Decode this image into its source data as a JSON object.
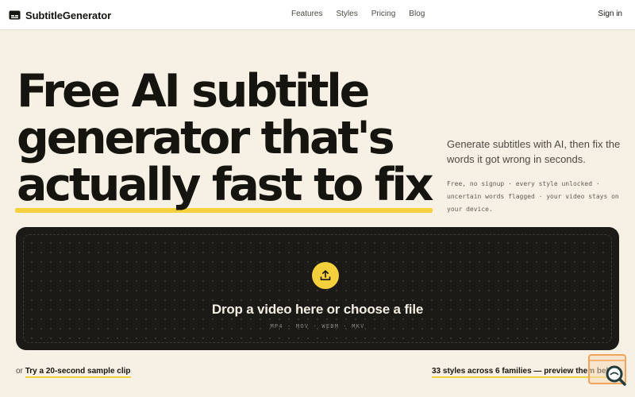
{
  "brand": {
    "name": "SubtitleGenerator",
    "icon": "captions-icon"
  },
  "nav": {
    "links": [
      "Features",
      "Styles",
      "Pricing",
      "Blog"
    ],
    "signin": "Sign in"
  },
  "hero": {
    "title_lines": [
      "Free AI subtitle",
      "generator that's",
      "actually fast to fix"
    ],
    "subtitle": "Generate subtitles with AI, then fix the words it got wrong in seconds.",
    "note": "Free, no signup · every style unlocked · uncertain words flagged · your video stays on your device."
  },
  "dropzone": {
    "title": "Drop a video here or choose a file",
    "formats": "MP4 · MOV · WEBM · MKV",
    "icon": "upload-icon"
  },
  "sample": {
    "prefix": "or",
    "link": "Try a 20-second sample clip"
  },
  "styles_link": "33 styles across 6 families — preview them below",
  "colors": {
    "accent": "#f4d13c",
    "dark": "#1b1a16",
    "background": "#f6f1e4"
  },
  "widget": {
    "icon": "search-zoom-icon"
  }
}
